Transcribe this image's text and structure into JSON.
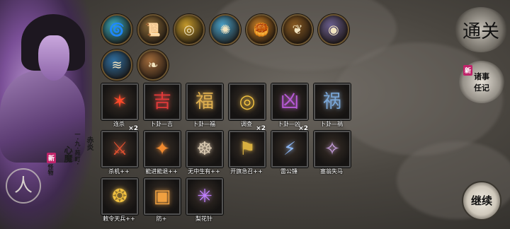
{
  "character": {
    "subtitle": "一·九·苑町·",
    "title_a": "赤炎",
    "title_b": "心魔",
    "name_small": "怪物",
    "new_badge": "新"
  },
  "top_relics": [
    {
      "name": "spiral-relic-icon",
      "glyph": "🌀",
      "color": "#3aa6b7"
    },
    {
      "name": "scroll-relic-icon",
      "glyph": "📜",
      "color": "#8a6a38"
    },
    {
      "name": "ring-relic-icon",
      "glyph": "◎",
      "color": "#c59a2b"
    },
    {
      "name": "light-relic-icon",
      "glyph": "✺",
      "color": "#4aa0c7"
    },
    {
      "name": "pie-relic-icon",
      "glyph": "🥮",
      "color": "#c07a25"
    },
    {
      "name": "gold-chain-relic-icon",
      "glyph": "❦",
      "color": "#8a5b22"
    },
    {
      "name": "eye-relic-icon",
      "glyph": "◉",
      "color": "#6a5e8c"
    },
    {
      "name": "blue-wave-relic-icon",
      "glyph": "≋",
      "color": "#2f6d9e"
    },
    {
      "name": "leaf-relic-icon",
      "glyph": "❧",
      "color": "#a06a3a"
    }
  ],
  "cards": [
    {
      "label": "连杀",
      "glyph": "✶",
      "color": "#ff4a2a",
      "count": ""
    },
    {
      "label": "卜卦—吉",
      "glyph": "吉",
      "color": "#e13a3a",
      "count": ""
    },
    {
      "label": "卜卦—福",
      "glyph": "福",
      "color": "#e0b050",
      "count": ""
    },
    {
      "label": "调查",
      "glyph": "◎",
      "color": "#f0c040",
      "count": ""
    },
    {
      "label": "卜卦—凶",
      "glyph": "凶",
      "color": "#b85ad8",
      "count": ""
    },
    {
      "label": "卜卦—祸",
      "glyph": "祸",
      "color": "#7aa7d8",
      "count": ""
    },
    {
      "label": "杀机++",
      "glyph": "⚔",
      "color": "#e05030",
      "count": "×2"
    },
    {
      "label": "能进能退++",
      "glyph": "✦",
      "color": "#f08a30",
      "count": ""
    },
    {
      "label": "无中生有++",
      "glyph": "☸",
      "color": "#d8c8b0",
      "count": ""
    },
    {
      "label": "开旗急召++",
      "glyph": "⚑",
      "color": "#d8b040",
      "count": "×2"
    },
    {
      "label": "雷公锤",
      "glyph": "⚡",
      "color": "#8ab4f0",
      "count": "×2"
    },
    {
      "label": "塞翁失马",
      "glyph": "✧",
      "color": "#c8a0e0",
      "count": ""
    },
    {
      "label": "敕令天兵++",
      "glyph": "❂",
      "color": "#f0c040",
      "count": ""
    },
    {
      "label": "防+",
      "glyph": "▣",
      "color": "#f0a040",
      "count": ""
    },
    {
      "label": "梨花针",
      "glyph": "✳",
      "color": "#c080ff",
      "count": ""
    }
  ],
  "side": {
    "tonghua": "通关",
    "story_line1": "诸事",
    "story_line2": "任记",
    "story_new": "新",
    "continue_label": "继续"
  }
}
